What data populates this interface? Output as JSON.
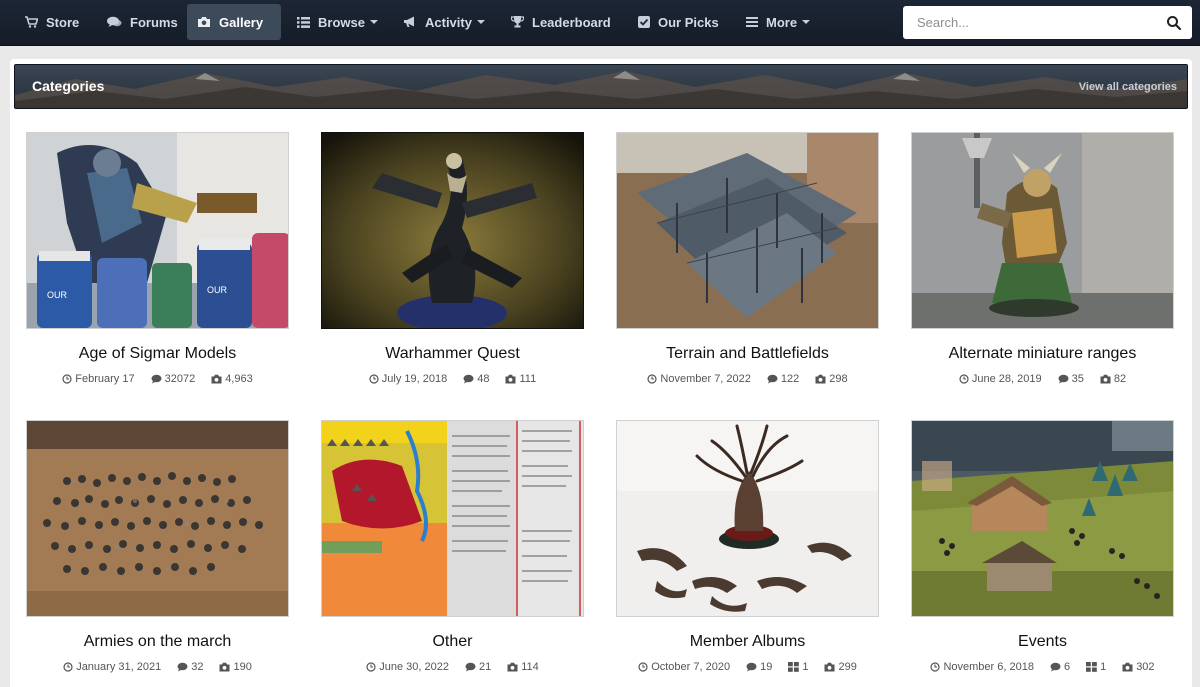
{
  "nav": {
    "items": [
      {
        "label": "Store",
        "icon": "store-icon"
      },
      {
        "label": "Forums",
        "icon": "forums-icon"
      },
      {
        "label": "Gallery",
        "icon": "camera-icon",
        "active": true
      },
      {
        "label": "Browse",
        "icon": "list-icon",
        "dropdown": true
      },
      {
        "label": "Activity",
        "icon": "megaphone-icon",
        "dropdown": true
      },
      {
        "label": "Leaderboard",
        "icon": "trophy-icon"
      },
      {
        "label": "Our Picks",
        "icon": "checkbox-icon"
      },
      {
        "label": "More",
        "icon": "menu-icon",
        "dropdown": true
      }
    ],
    "search_placeholder": "Search..."
  },
  "panel": {
    "title": "Categories",
    "view_all_label": "View all categories"
  },
  "categories": [
    {
      "title": "Age of Sigmar Models",
      "date": "February 17",
      "comments": "32072",
      "images": "4,963"
    },
    {
      "title": "Warhammer Quest",
      "date": "July 19, 2018",
      "comments": "48",
      "images": "111"
    },
    {
      "title": "Terrain and Battlefields",
      "date": "November 7, 2022",
      "comments": "122",
      "images": "298"
    },
    {
      "title": "Alternate miniature ranges",
      "date": "June 28, 2019",
      "comments": "35",
      "images": "82"
    },
    {
      "title": "Armies on the march",
      "date": "January 31, 2021",
      "comments": "32",
      "images": "190"
    },
    {
      "title": "Other",
      "date": "June 30, 2022",
      "comments": "21",
      "images": "114"
    },
    {
      "title": "Member Albums",
      "date": "October 7, 2020",
      "comments": "19",
      "albums": "1",
      "images": "299"
    },
    {
      "title": "Events",
      "date": "November 6, 2018",
      "comments": "6",
      "albums": "1",
      "images": "302"
    }
  ],
  "colors": {
    "nav_bg": "#1d2634",
    "nav_active": "#3d4a5a",
    "header_bg": "#28333f",
    "page_bg": "#e9e9e9"
  }
}
